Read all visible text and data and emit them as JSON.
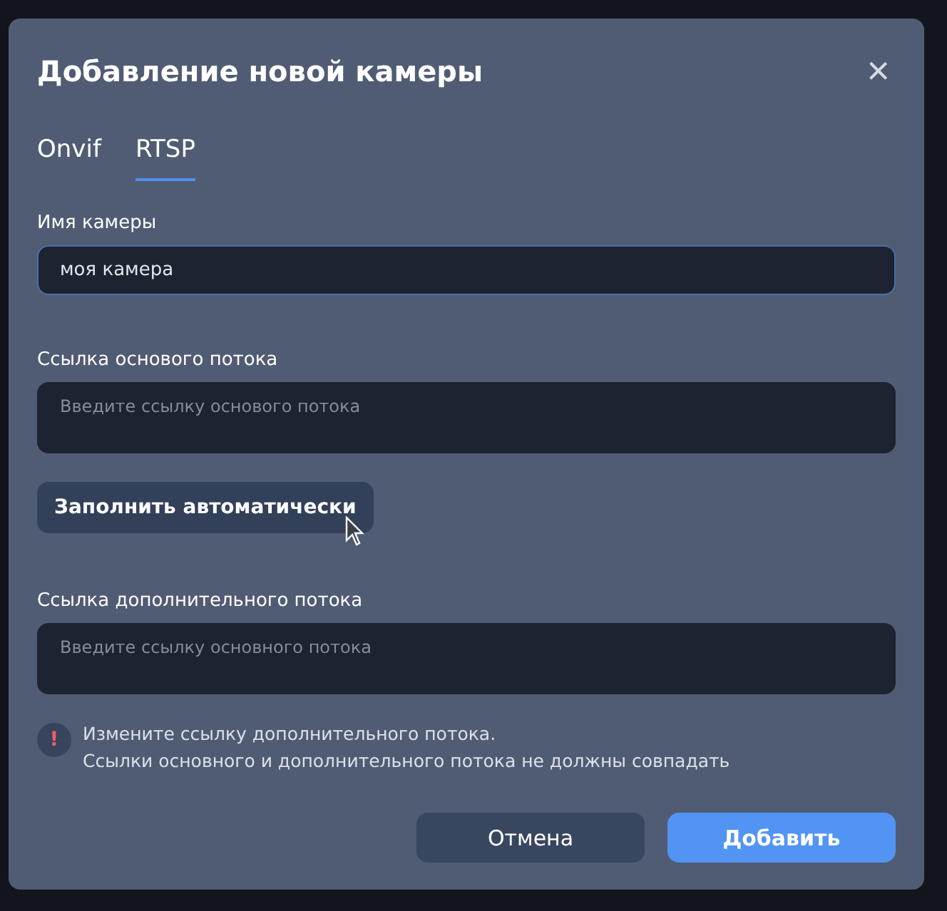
{
  "dialog": {
    "title": "Добавление новой камеры",
    "close": "×"
  },
  "tabs": [
    {
      "label": "Onvif",
      "selected": false
    },
    {
      "label": "RTSP",
      "selected": true
    }
  ],
  "fields": [
    {
      "label": "Имя камеры",
      "value": "моя камера",
      "focused": true
    },
    {
      "label": "Ссылка основого потока",
      "placeholder": "Введите ссылку основого потока",
      "focused": false
    },
    {
      "label": "Ссылка дополнительного потока",
      "placeholder": "Введите ссылку основного потока",
      "focused": false
    }
  ],
  "autofill_button": "Заполнить автоматически",
  "warning": {
    "icon": "!",
    "lines": [
      "Измените ссылку дополнительного потока.",
      "Ссылки основного и дополнительного потока не должны совпадать"
    ]
  },
  "buttons": [
    {
      "label": "Отмена",
      "kind": "secondary"
    },
    {
      "label": "Добавить",
      "kind": "primary"
    }
  ]
}
